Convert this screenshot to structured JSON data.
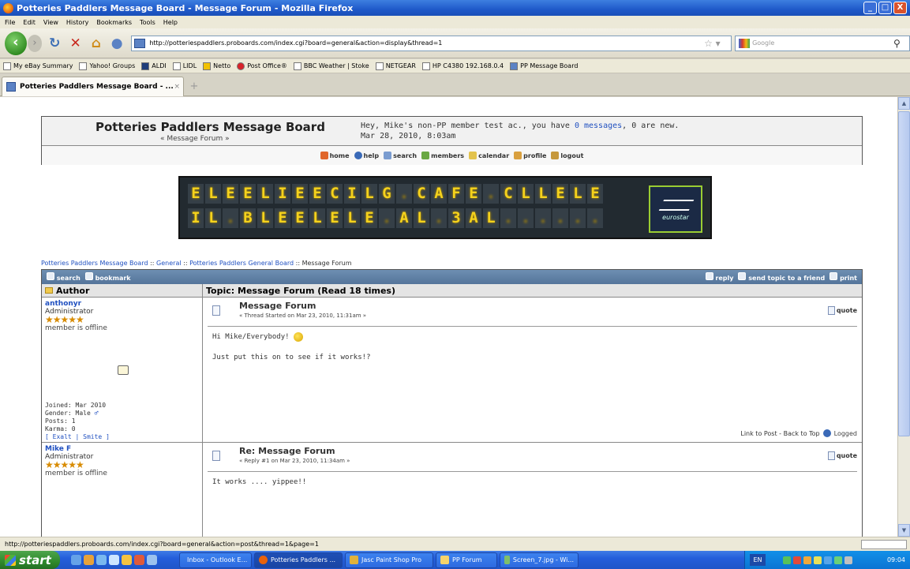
{
  "window": {
    "title": "Potteries Paddlers Message Board - Message Forum - Mozilla Firefox",
    "buttons": [
      "_",
      "□",
      "X"
    ]
  },
  "menu": [
    "File",
    "Edit",
    "View",
    "History",
    "Bookmarks",
    "Tools",
    "Help"
  ],
  "nav": {
    "url": "http://potteriespaddlers.proboards.com/index.cgi?board=general&action=display&thread=1",
    "search_placeholder": "Google"
  },
  "bookmarks": [
    "My eBay Summary",
    "Yahoo! Groups",
    "ALDI",
    "LIDL",
    "Netto",
    "Post Office®",
    "BBC Weather | Stoke",
    "NETGEAR",
    "HP C4380 192.168.0.4",
    "PP Message Board"
  ],
  "tab": {
    "label": "Potteries Paddlers Message Board - ..."
  },
  "forum": {
    "board_title": "Potteries Paddlers Message Board",
    "board_subtitle": "« Message Forum »",
    "greeting_prefix": "Hey, Mike's non-PP member test ac., you have ",
    "messages_count": "0",
    "messages_link": " messages",
    "greeting_suffix": ", 0 are new.",
    "date": "Mar 28, 2010, 8:03am",
    "toolbar": [
      "home",
      "help",
      "search",
      "members",
      "calendar",
      "profile",
      "logout"
    ],
    "banner_line1": [
      "E",
      "L",
      "E",
      "E",
      "L",
      "I",
      "E",
      "E",
      "C",
      "I",
      "L",
      "G",
      " ",
      "C",
      "A",
      "F",
      "E",
      " ",
      "C",
      "L",
      "L",
      "E",
      "L",
      "E"
    ],
    "banner_line2": [
      "I",
      "L",
      " ",
      "B",
      "L",
      "E",
      "E",
      "L",
      "E",
      "L",
      "E",
      " ",
      "A",
      "L",
      " ",
      "3",
      "A",
      "L",
      " ",
      " ",
      " ",
      " ",
      " ",
      " "
    ],
    "banner_logo": "eurostar",
    "breadcrumb": [
      "Potteries Paddlers Message Board",
      "General",
      "Potteries Paddlers General Board",
      "Message Forum"
    ],
    "breadcrumb_sep": " :: ",
    "thread_bar_left": [
      "search",
      "bookmark"
    ],
    "thread_bar_right": [
      "reply",
      "send topic to a friend",
      "print"
    ],
    "col_author": "Author",
    "col_topic": "Topic: Message Forum  (Read 18 times)",
    "posts": [
      {
        "author": "anthonyr",
        "rank": "Administrator",
        "stars": "★★★★★",
        "status": "member is offline",
        "joined": "Joined: Mar 2010",
        "gender": "Gender: Male",
        "posts": "Posts: 1",
        "karma": "Karma: 0",
        "karma_links": "[ Exalt | Smite ]",
        "title": "Message Forum",
        "meta": "« Thread Started on Mar 23, 2010, 11:31am »",
        "quote": "quote",
        "line1": "Hi Mike/Everybody!",
        "line2": "Just put this on to see if it works!?",
        "footer_links": "Link to Post - Back to Top",
        "footer_logged": "Logged"
      },
      {
        "author": "Mike F",
        "rank": "Administrator",
        "stars": "★★★★★",
        "status": "member is offline",
        "title": "Re: Message Forum",
        "meta": "« Reply #1 on Mar 23, 2010, 11:34am »",
        "quote": "quote",
        "line1": "It works .... yippee!!"
      }
    ]
  },
  "status": {
    "text": "http://potteriespaddlers.proboards.com/index.cgi?board=general&action=post&thread=1&page=1"
  },
  "taskbar": {
    "start": "start",
    "tasks": [
      "Inbox - Outlook E...",
      "Potteries Paddlers ...",
      "Jasc Paint Shop Pro",
      "PP Forum",
      "Screen_7.jpg - Wi..."
    ],
    "lang": "EN",
    "clock": "09:04"
  }
}
